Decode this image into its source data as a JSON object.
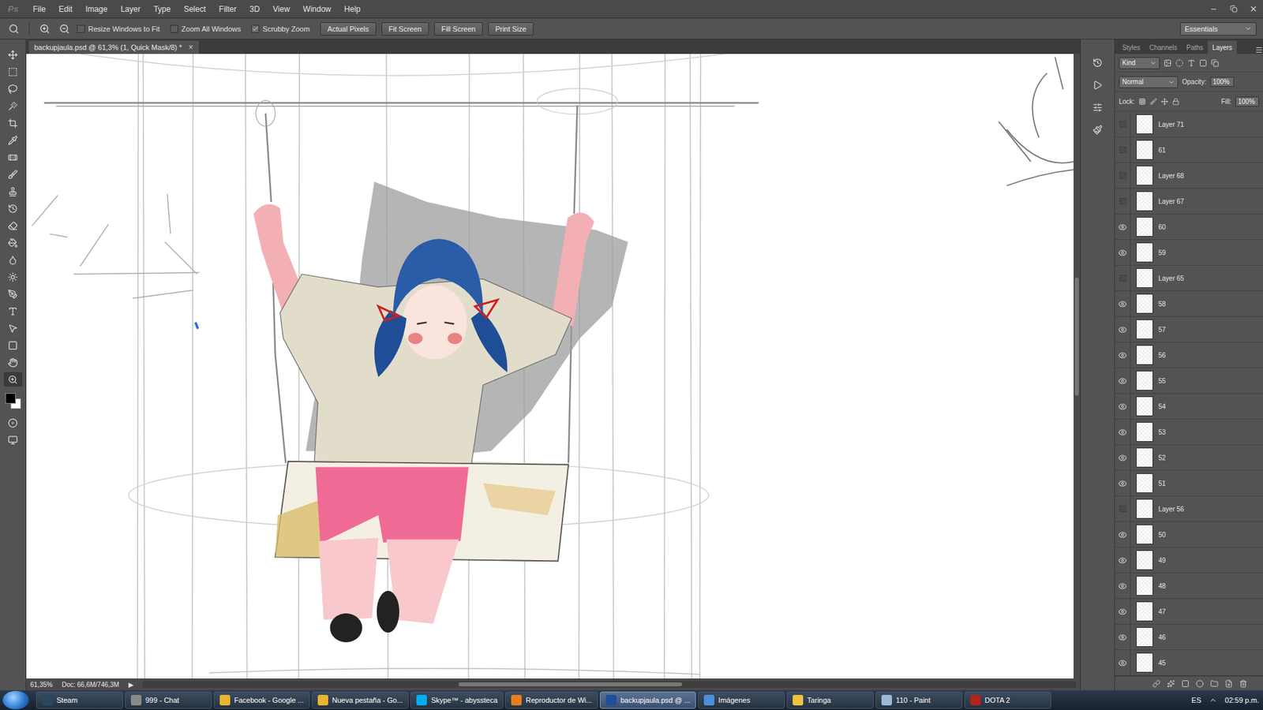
{
  "app": {
    "logo": "Ps"
  },
  "menu": [
    "File",
    "Edit",
    "Image",
    "Layer",
    "Type",
    "Select",
    "Filter",
    "3D",
    "View",
    "Window",
    "Help"
  ],
  "options_bar": {
    "checkboxes": [
      {
        "label": "Resize Windows to Fit",
        "checked": false
      },
      {
        "label": "Zoom All Windows",
        "checked": false
      },
      {
        "label": "Scrubby Zoom",
        "checked": true
      }
    ],
    "buttons": [
      "Actual Pixels",
      "Fit Screen",
      "Fill Screen",
      "Print Size"
    ],
    "workspace": "Essentials"
  },
  "document": {
    "tab_title": "backupjaula.psd @ 61,3% (1, Quick Mask/8) *",
    "close": "×"
  },
  "status_bar": {
    "zoom": "61,35%",
    "doc_size": "Doc: 66,6M/746,3M",
    "arrow": "▶"
  },
  "panel_tabs": [
    {
      "label": "Styles",
      "selected": false
    },
    {
      "label": "Channels",
      "selected": false
    },
    {
      "label": "Paths",
      "selected": false
    },
    {
      "label": "Layers",
      "selected": true
    }
  ],
  "layers_panel": {
    "filter": "Kind",
    "blend_mode": "Normal",
    "opacity_label": "Opacity:",
    "opacity": "100%",
    "lock_label": "Lock:",
    "fill_label": "Fill:",
    "fill": "100%",
    "layers": [
      {
        "name": "Layer 71",
        "visible": false
      },
      {
        "name": "61",
        "visible": false
      },
      {
        "name": "Layer 68",
        "visible": false
      },
      {
        "name": "Layer 67",
        "visible": false
      },
      {
        "name": "60",
        "visible": true
      },
      {
        "name": "59",
        "visible": true
      },
      {
        "name": "Layer 65",
        "visible": false
      },
      {
        "name": "58",
        "visible": true
      },
      {
        "name": "57",
        "visible": true
      },
      {
        "name": "56",
        "visible": true
      },
      {
        "name": "55",
        "visible": true
      },
      {
        "name": "54",
        "visible": true
      },
      {
        "name": "53",
        "visible": true
      },
      {
        "name": "52",
        "visible": true
      },
      {
        "name": "51",
        "visible": true
      },
      {
        "name": "Layer 56",
        "visible": false
      },
      {
        "name": "50",
        "visible": true
      },
      {
        "name": "49",
        "visible": true
      },
      {
        "name": "48",
        "visible": true
      },
      {
        "name": "47",
        "visible": true
      },
      {
        "name": "46",
        "visible": true
      },
      {
        "name": "45",
        "visible": true
      }
    ]
  },
  "taskbar": {
    "items": [
      {
        "label": "Steam",
        "selected": false,
        "color": "#2a475e"
      },
      {
        "label": "999 - Chat",
        "selected": false,
        "color": "#8a8a8a"
      },
      {
        "label": "Facebook - Google ...",
        "selected": false,
        "color": "#e8b530"
      },
      {
        "label": "Nueva pestaña - Go...",
        "selected": false,
        "color": "#e8b530"
      },
      {
        "label": "Skype™ - abyssteca",
        "selected": false,
        "color": "#00aff0"
      },
      {
        "label": "Reproductor de Wi...",
        "selected": false,
        "color": "#e67e22"
      },
      {
        "label": "backupjaula.psd @ ...",
        "selected": true,
        "color": "#1e4f9c"
      },
      {
        "label": "Imágenes",
        "selected": false,
        "color": "#4a90d9"
      },
      {
        "label": "Taringa",
        "selected": false,
        "color": "#f0c040"
      },
      {
        "label": "110 - Paint",
        "selected": false,
        "color": "#9bb8d8"
      },
      {
        "label": "DOTA 2",
        "selected": false,
        "color": "#b0251b"
      }
    ],
    "tray": {
      "language": "ES",
      "time": "02:59 p.m."
    }
  }
}
